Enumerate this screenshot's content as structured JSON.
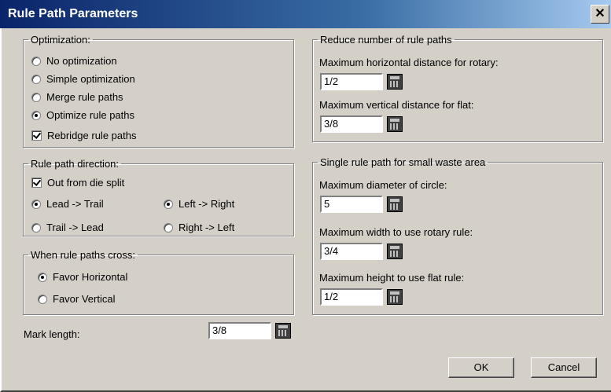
{
  "window": {
    "title": "Rule Path Parameters",
    "close_glyph": "✕"
  },
  "optimization": {
    "legend": "Optimization:",
    "options": [
      {
        "label": "No optimization",
        "selected": false
      },
      {
        "label": "Simple optimization",
        "selected": false
      },
      {
        "label": "Merge rule paths",
        "selected": false
      },
      {
        "label": "Optimize rule paths",
        "selected": true
      }
    ],
    "rebridge": {
      "label": "Rebridge rule paths",
      "checked": true
    }
  },
  "direction": {
    "legend": "Rule path direction:",
    "out_from_die": {
      "label": "Out from die split",
      "checked": true
    },
    "lead_trail": "Lead -> Trail",
    "trail_lead": "Trail -> Lead",
    "left_right": "Left -> Right",
    "right_left": "Right -> Left"
  },
  "cross": {
    "legend": "When rule paths cross:",
    "favor_horizontal": "Favor Horizontal",
    "favor_vertical": "Favor Vertical"
  },
  "mark_length": {
    "label": "Mark length:",
    "value": "3/8"
  },
  "reduce": {
    "legend": "Reduce number of rule paths",
    "rotary_label": "Maximum horizontal distance for rotary:",
    "rotary_value": "1/2",
    "flat_label": "Maximum vertical distance for flat:",
    "flat_value": "3/8"
  },
  "single": {
    "legend": "Single rule path for small waste area",
    "circle_label": "Maximum diameter of circle:",
    "circle_value": "5",
    "rotary_label": "Maximum width to use rotary rule:",
    "rotary_value": "3/4",
    "flat_label": "Maximum height to use flat rule:",
    "flat_value": "1/2"
  },
  "buttons": {
    "ok": "OK",
    "cancel": "Cancel"
  },
  "icons": {
    "calculator": "calculator-icon",
    "close": "close-icon"
  }
}
